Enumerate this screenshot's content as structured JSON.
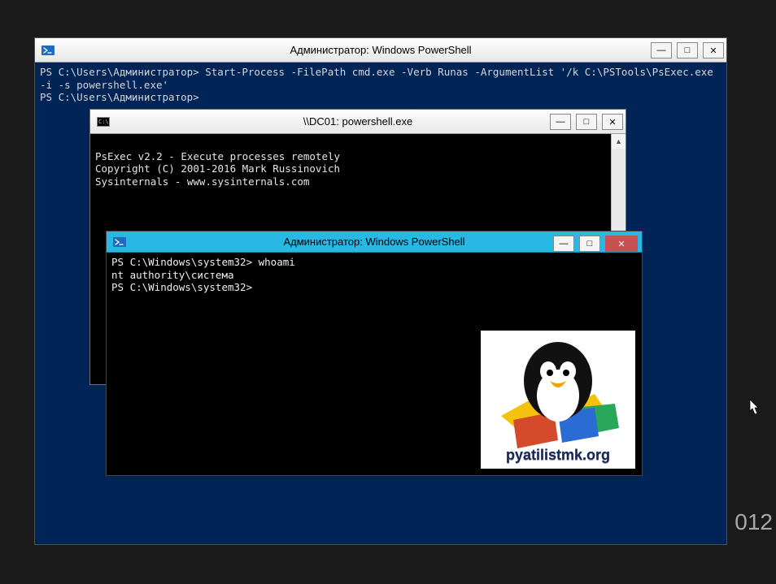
{
  "desktop": {
    "corner_text": "012 "
  },
  "win1": {
    "title": "Администратор: Windows PowerShell",
    "btn_min": "—",
    "btn_max": "□",
    "btn_close": "✕",
    "lines": "PS C:\\Users\\Администратор> Start-Process -FilePath cmd.exe -Verb Runas -ArgumentList '/k C:\\PSTools\\PsExec.exe -i -s powershell.exe'\nPS C:\\Users\\Администратор>"
  },
  "win2": {
    "title": "\\\\DC01: powershell.exe",
    "btn_min": "—",
    "btn_max": "□",
    "btn_close": "✕",
    "scroll_up": "▲",
    "scroll_down": "▼",
    "lines": "\nPsExec v2.2 - Execute processes remotely\nCopyright (C) 2001-2016 Mark Russinovich\nSysinternals - www.sysinternals.com\n"
  },
  "win3": {
    "title": "Администратор: Windows PowerShell",
    "btn_min": "—",
    "btn_max": "□",
    "btn_close": "✕",
    "lines": "PS C:\\Windows\\system32> whoami\nnt authority\\система\nPS C:\\Windows\\system32>"
  },
  "logo": {
    "site": "pyatilistmk.org"
  },
  "cmd_prompt_text": "C:\\"
}
